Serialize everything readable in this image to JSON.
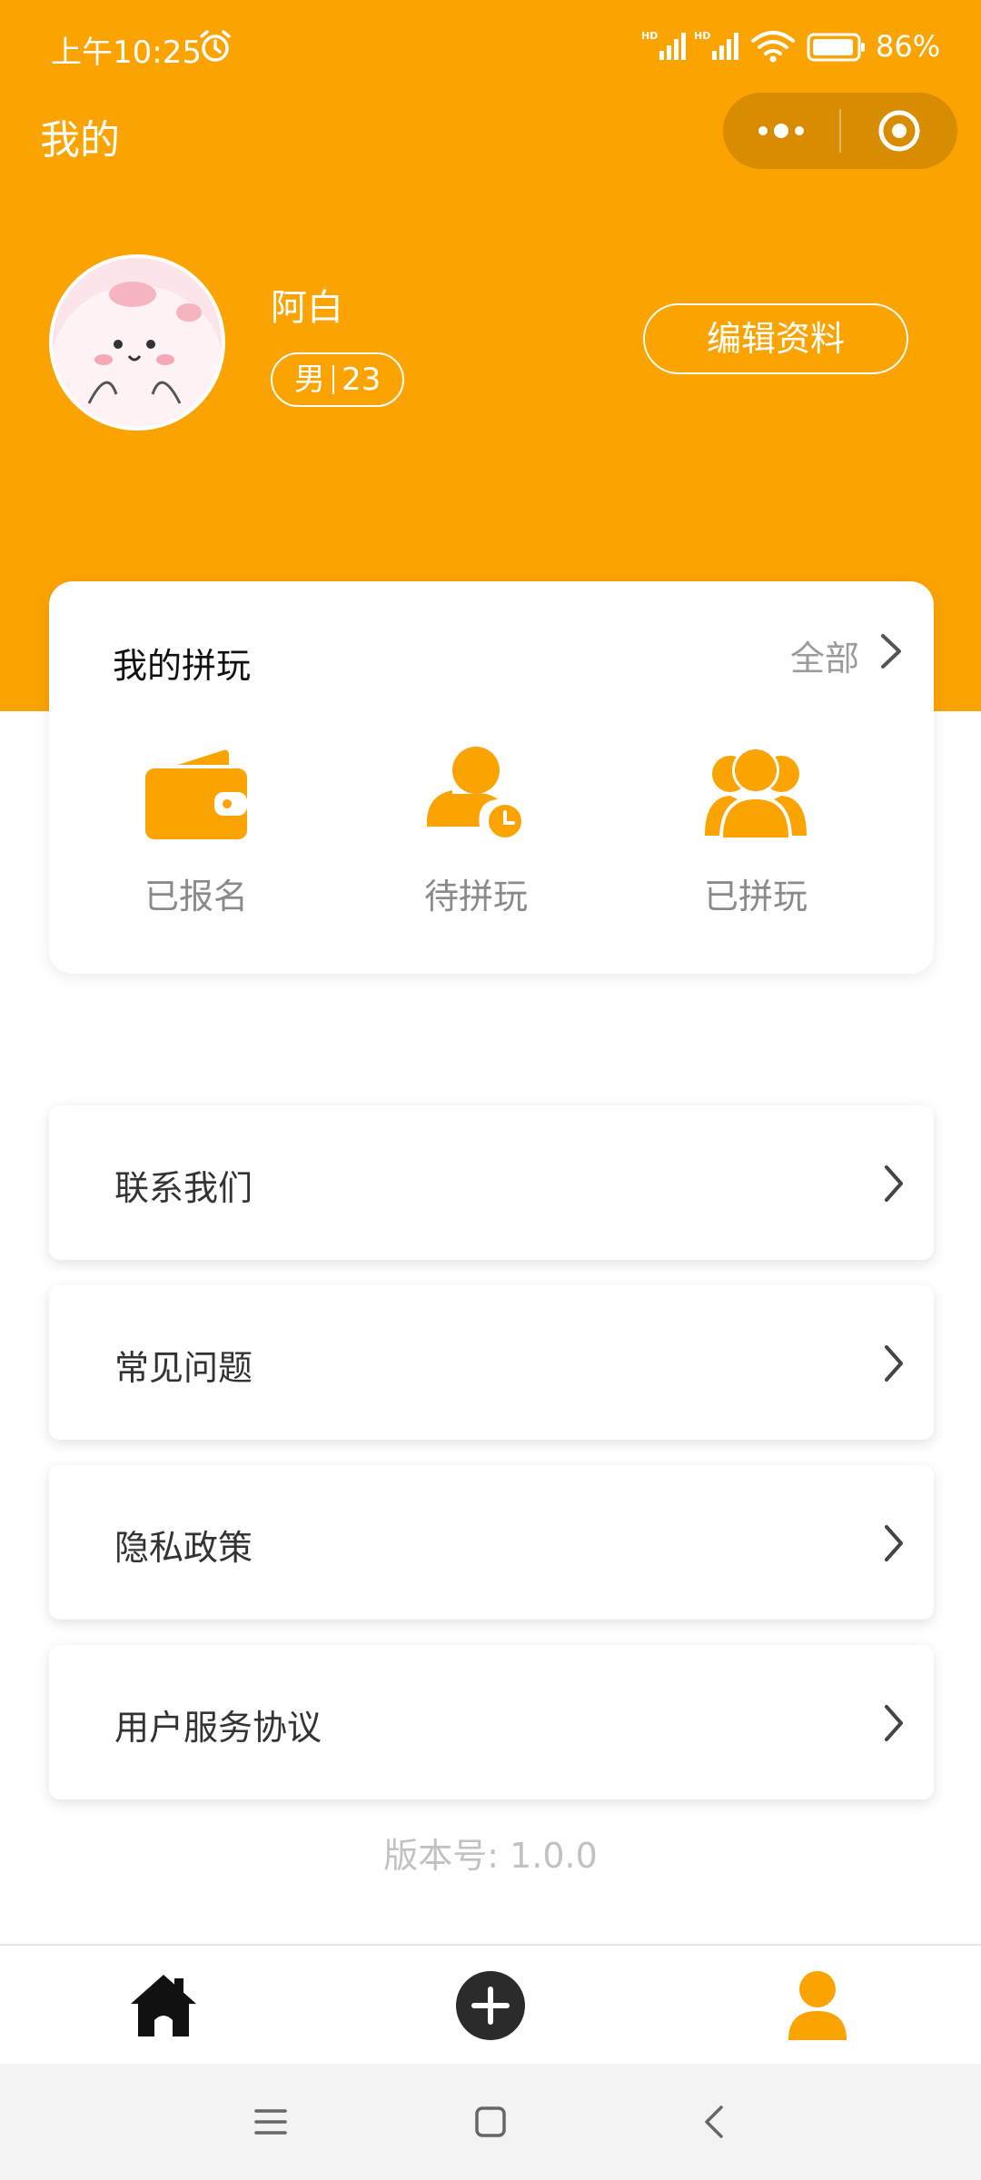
{
  "status_bar": {
    "time": "上午10:25",
    "battery": "86%"
  },
  "header": {
    "title": "我的"
  },
  "profile": {
    "name": "阿白",
    "gender": "男",
    "age": "23",
    "edit_label": "编辑资料"
  },
  "activity_card": {
    "title": "我的拼玩",
    "all_label": "全部",
    "items": [
      {
        "label": "已报名",
        "icon": "wallet-icon"
      },
      {
        "label": "待拼玩",
        "icon": "user-clock-icon"
      },
      {
        "label": "已拼玩",
        "icon": "users-icon"
      }
    ]
  },
  "menu": [
    {
      "label": "联系我们"
    },
    {
      "label": "常见问题"
    },
    {
      "label": "隐私政策"
    },
    {
      "label": "用户服务协议"
    }
  ],
  "version": "版本号: 1.0.0",
  "tabbar": {
    "tabs": [
      {
        "icon": "home-icon"
      },
      {
        "icon": "add-circle-icon"
      },
      {
        "icon": "profile-icon"
      }
    ],
    "active_color": "#FBA301"
  },
  "colors": {
    "brand": "#FBA301"
  }
}
